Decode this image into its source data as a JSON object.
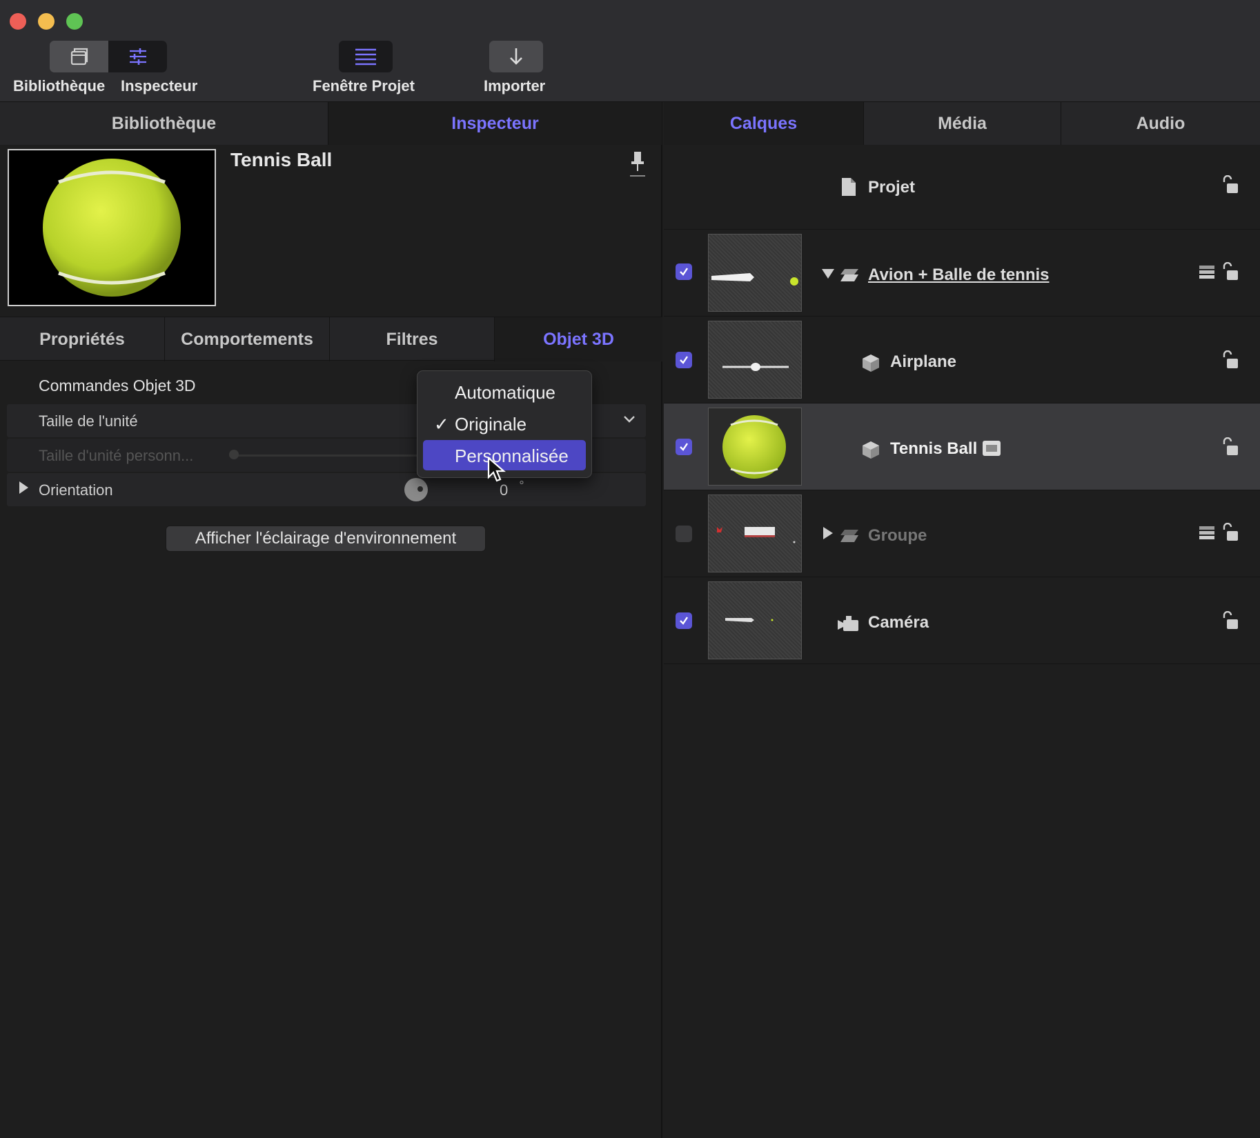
{
  "toolbar": {
    "library_label": "Bibliothèque",
    "inspector_label": "Inspecteur",
    "project_window_label": "Fenêtre Projet",
    "import_label": "Importer"
  },
  "left_tabs": [
    "Bibliothèque",
    "Inspecteur"
  ],
  "left_active_tab": "Inspecteur",
  "object": {
    "title": "Tennis Ball"
  },
  "sub_tabs": [
    "Propriétés",
    "Comportements",
    "Filtres",
    "Objet 3D"
  ],
  "sub_active_tab": "Objet 3D",
  "controls": {
    "section_title": "Commandes Objet 3D",
    "unit_size_label": "Taille de l'unité",
    "custom_unit_size_label": "Taille d'unité personn...",
    "orientation_label": "Orientation",
    "orientation_value": "0",
    "orientation_unit": "°",
    "env_lighting_button": "Afficher l'éclairage d'environnement"
  },
  "unit_size_menu": {
    "options": [
      "Automatique",
      "Originale",
      "Personnalisée"
    ],
    "checked": "Originale",
    "highlighted": "Personnalisée",
    "check_glyph": "✓"
  },
  "right_tabs": [
    "Calques",
    "Média",
    "Audio"
  ],
  "right_active_tab": "Calques",
  "layers": {
    "project": "Projet",
    "items": [
      {
        "name": "Avion + Balle de tennis",
        "checked": true,
        "type": "group",
        "expanded": true
      },
      {
        "name": "Airplane",
        "checked": true,
        "type": "3d-object"
      },
      {
        "name": "Tennis Ball",
        "checked": true,
        "type": "3d-object",
        "selected": true
      },
      {
        "name": "Groupe",
        "checked": false,
        "type": "group",
        "expanded": false
      },
      {
        "name": "Caméra",
        "checked": true,
        "type": "camera"
      }
    ]
  },
  "colors": {
    "accent": "#7b74ff",
    "menu_highlight": "#4d47c4",
    "checkbox": "#5b55d6",
    "tennis_ball": "#c9e52c"
  }
}
